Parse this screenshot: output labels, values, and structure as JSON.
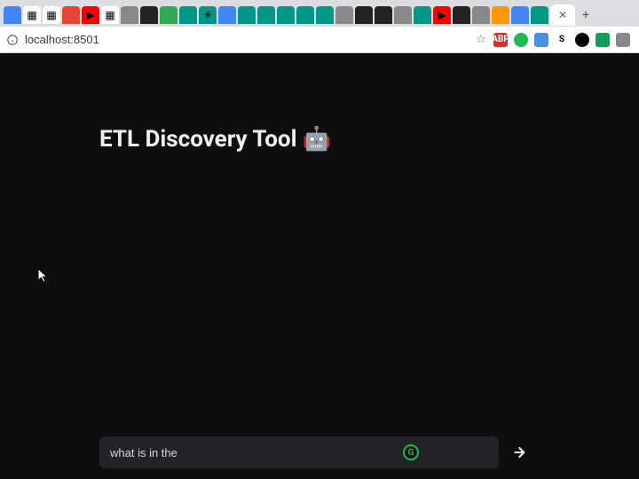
{
  "browser": {
    "address": "localhost:8501",
    "new_tab_label": "+",
    "active_tab_close": "✕",
    "star_icon": "☆",
    "ext_abp": "ABP",
    "ext_s": "S"
  },
  "app": {
    "title": "ETL Discovery Tool",
    "title_emoji": "🤖"
  },
  "chat": {
    "input_value": "what is in the",
    "grammarly_label": "G"
  }
}
